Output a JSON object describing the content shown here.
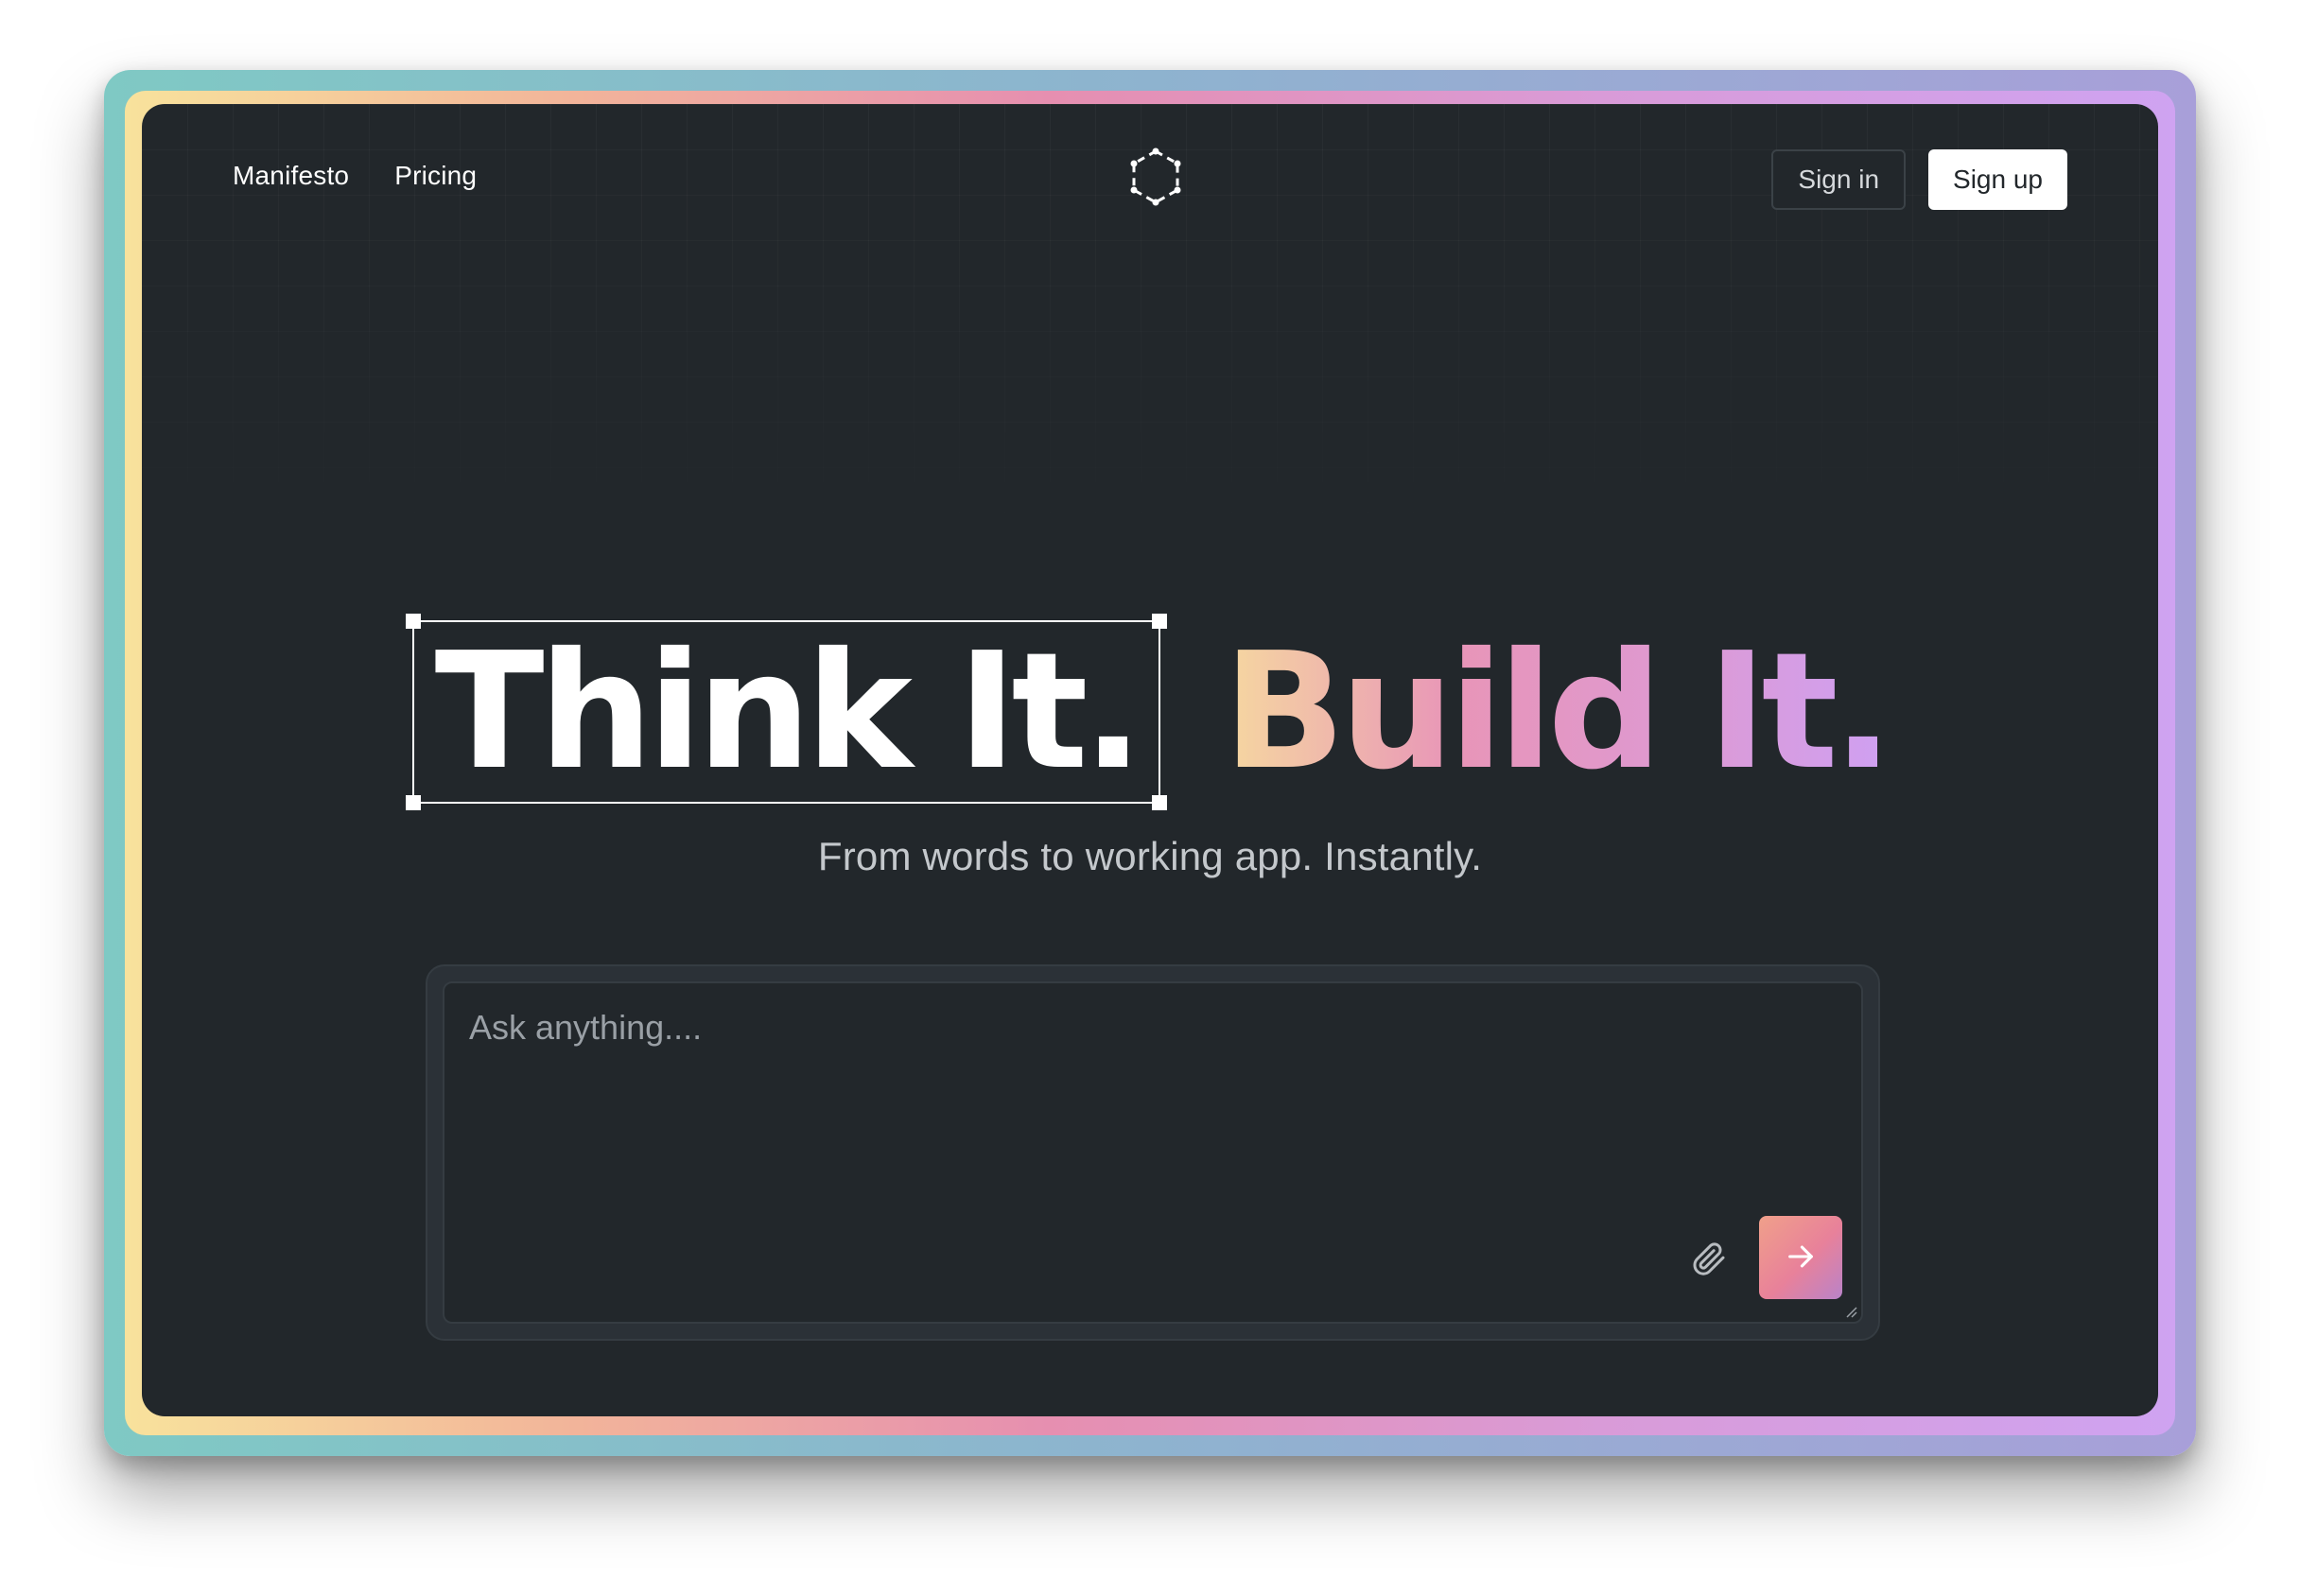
{
  "nav": {
    "links": [
      {
        "label": "Manifesto"
      },
      {
        "label": "Pricing"
      }
    ],
    "logo_icon": "hexagon-dots-icon",
    "sign_in_label": "Sign in",
    "sign_up_label": "Sign up"
  },
  "hero": {
    "headline_part1": "Think It.",
    "headline_part2": "Build It.",
    "tagline": "From words to working app. Instantly."
  },
  "prompt": {
    "placeholder": "Ask anything....",
    "value": "",
    "attach_icon": "paperclip-icon",
    "send_icon": "arrow-right-icon"
  },
  "colors": {
    "panel_bg": "#22272b",
    "accent_gradient": [
      "#f6d8a0",
      "#e895b8",
      "#cfa0f2"
    ],
    "send_button_gradient": [
      "#f0a08a",
      "#e8819a",
      "#b983c9"
    ]
  }
}
